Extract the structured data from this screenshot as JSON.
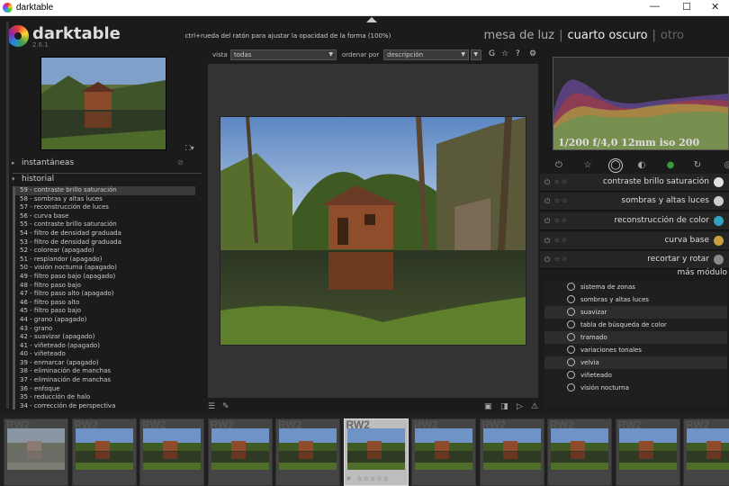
{
  "window": {
    "title": "darktable",
    "controls": [
      "—",
      "☐",
      "✕"
    ]
  },
  "app": {
    "name": "darktable",
    "version": "2.6.1"
  },
  "hint": "ctrl+rueda del ratón para ajustar la opacidad de la forma (100%)",
  "views": {
    "lighttable": "mesa de luz",
    "darkroom": "cuarto oscuro",
    "other": "otro",
    "sep": "|"
  },
  "topbar": {
    "view_label": "vista",
    "view_value": "todas",
    "sort_label": "ordenar por",
    "sort_value": "descripción",
    "icons": {
      "grouping": "G",
      "star": "☆",
      "help": "?",
      "prefs": "⚙"
    }
  },
  "left": {
    "nav_expand": "⛶▾",
    "snapshots": {
      "label": "instantáneas",
      "arrow": "▸",
      "dot": "⊘"
    },
    "history": {
      "label": "historial",
      "arrow": "▾",
      "items": [
        "59 - contraste brillo saturación",
        "58 - sombras y altas luces",
        "57 - reconstrucción de luces",
        "56 - curva base",
        "55 - contraste brillo saturación",
        "54 - filtro de densidad graduada",
        "53 - filtro de densidad graduada",
        "52 - colorear (apagado)",
        "51 - resplandor (apagado)",
        "50 - visión nocturna (apagado)",
        "49 - filtro paso bajo (apagado)",
        "48 - filtro paso bajo",
        "47 - filtro paso alto (apagado)",
        "46 - filtro paso alto",
        "45 - filtro paso bajo",
        "44 - grano (apagado)",
        "43 - grano",
        "42 - suavizar (apagado)",
        "41 - viñeteado (apagado)",
        "40 - viñeteado",
        "39 - enmarcar (apagado)",
        "38 - eliminación de manchas",
        "37 - eliminación de manchas",
        "36 - enfoque",
        "35 - reducción de halo",
        "34 - corrección de perspectiva"
      ]
    }
  },
  "bottom_icons": {
    "menu": "☰",
    "styles": "✎",
    "color": "▣",
    "softproof": "◨",
    "gamut": "▷",
    "warn": "⚠"
  },
  "right": {
    "exif": "1/200 f/4,0 12mm iso 200",
    "groups": [
      {
        "icon": "power-icon",
        "glyph": "⏻"
      },
      {
        "icon": "star-icon",
        "glyph": "☆"
      },
      {
        "icon": "circle-icon",
        "glyph": "◯"
      },
      {
        "icon": "tone-icon",
        "glyph": "◐"
      },
      {
        "icon": "color-icon",
        "glyph": "●"
      },
      {
        "icon": "correct-icon",
        "glyph": "↻"
      },
      {
        "icon": "effect-icon",
        "glyph": "◎"
      }
    ],
    "modules": [
      {
        "name": "contraste brillo saturación",
        "on": "⏻",
        "ex": "≡ ⊘",
        "color": "#e0e0e0"
      },
      {
        "name": "sombras y altas luces",
        "on": "⏻",
        "ex": "≡ ⊘",
        "color": "#cccccc"
      },
      {
        "name": "reconstrucción de color",
        "on": "⏻",
        "ex": "≡ ⊘",
        "color": "#2fa3c4"
      },
      {
        "name": "curva base",
        "on": "⏻",
        "ex": "≡ ⊘",
        "color": "#c9a23f"
      },
      {
        "name": "recortar y rotar",
        "on": "⏻",
        "ex": "≡ ⊘",
        "color": "#8a8a8a"
      }
    ],
    "more_label": "más módulo",
    "more_modules": [
      "sistema de zonas",
      "sombras y altas luces",
      "suavizar",
      "tabla de búsqueda de color",
      "tramado",
      "variaciones tonales",
      "velvia",
      "viñeteado",
      "visión nocturna"
    ]
  },
  "filmstrip": {
    "ext_label": "RW2",
    "current_index": 5,
    "reject": "✕",
    "stars": "☆☆☆☆☆",
    "thumb_count": 11
  }
}
